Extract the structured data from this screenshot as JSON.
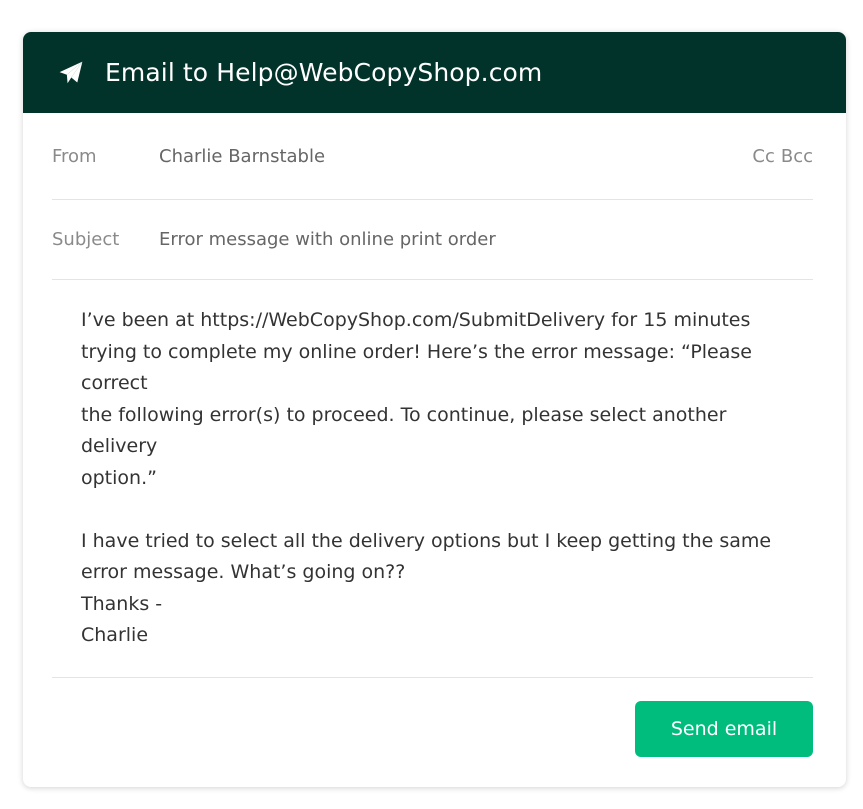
{
  "header": {
    "icon": "paper-plane-icon",
    "title": "Email to Help@WebCopyShop.com",
    "background": "#02332b"
  },
  "from": {
    "label": "From",
    "value": "Charlie Barnstable",
    "cc_label": "Cc",
    "bcc_label": "Bcc"
  },
  "subject": {
    "label": "Subject",
    "value": "Error message with online print order"
  },
  "message": {
    "body": "I’ve been at https://WebCopyShop.com/SubmitDelivery for 15 minutes\ntrying to complete my online order! Here’s the error message: “Please correct\nthe following error(s) to proceed. To continue, please select another delivery\noption.”\n\nI have tried to select all the delivery options but I keep getting the same\nerror message. What’s going on??\nThanks -\nCharlie"
  },
  "actions": {
    "send_label": "Send email",
    "send_color": "#00bd7e"
  }
}
